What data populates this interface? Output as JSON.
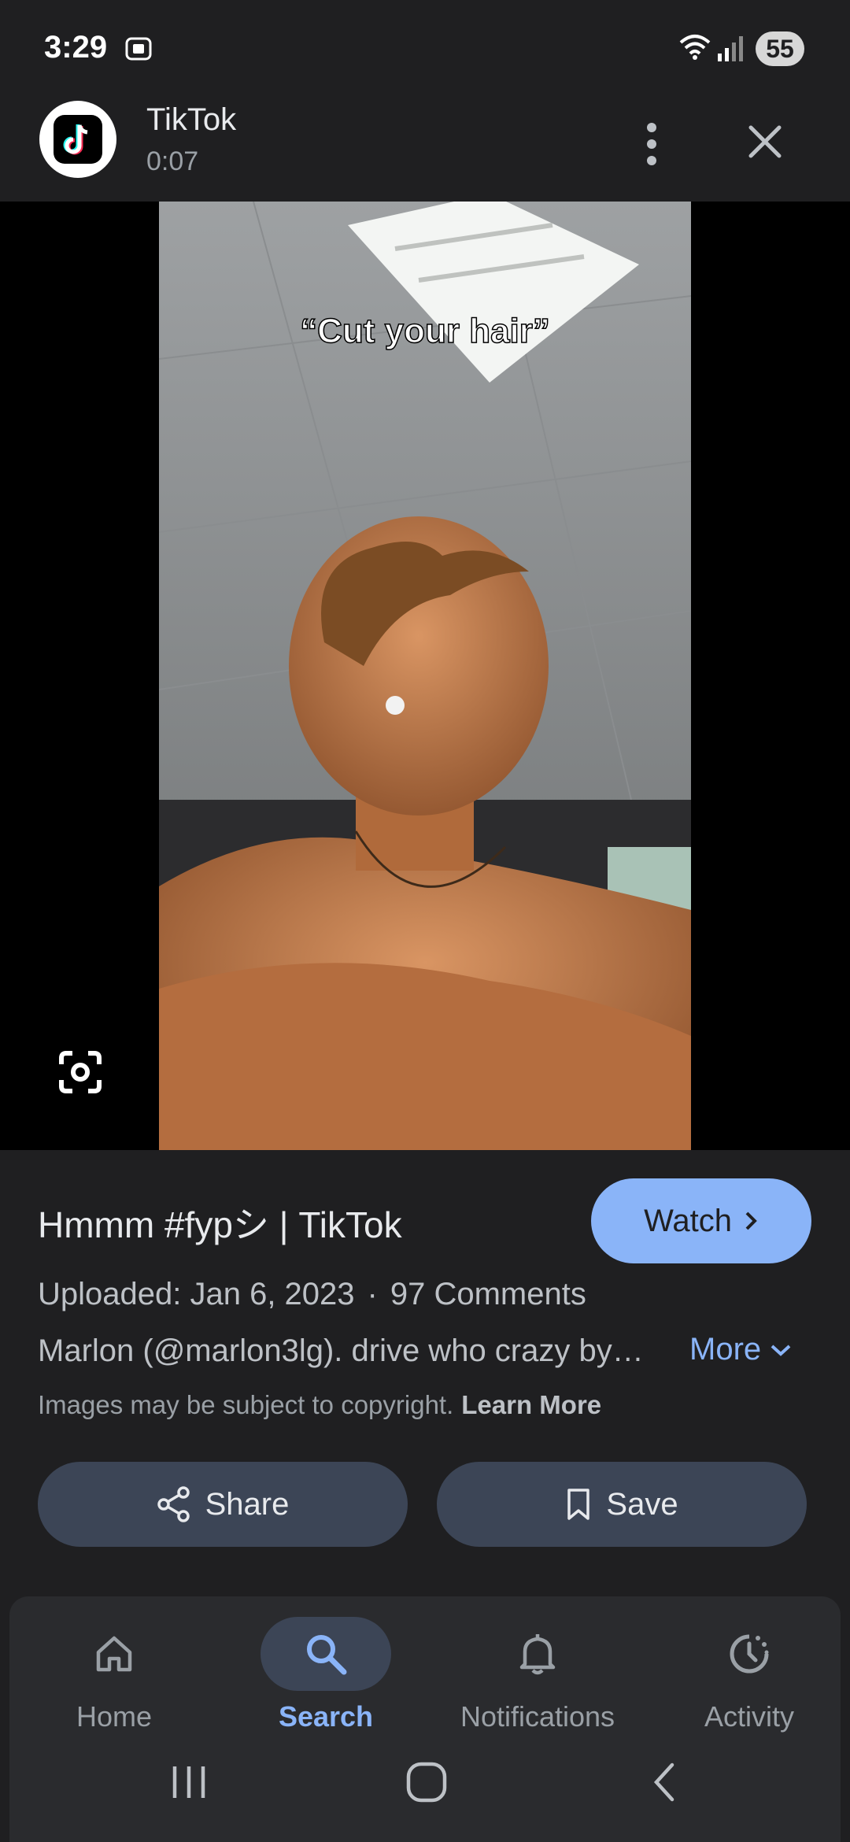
{
  "status_bar": {
    "time": "3:29",
    "battery": "55"
  },
  "header": {
    "app_name": "TikTok",
    "duration": "0:07"
  },
  "media": {
    "caption": "“Cut your hair”"
  },
  "info": {
    "title": "Hmmm #fypシ | TikTok",
    "watch_label": "Watch",
    "uploaded": "Uploaded: Jan 6, 2023",
    "separator": "·",
    "comments": "97 Comments",
    "description": "Marlon (@marlon3lg). drive who crazy by…",
    "more_label": "More",
    "copyright_text": "Images may be subject to copyright.",
    "learn_more": "Learn More"
  },
  "actions": {
    "share_label": "Share",
    "save_label": "Save"
  },
  "nav": {
    "items": [
      {
        "label": "Home",
        "icon": "home-icon"
      },
      {
        "label": "Search",
        "icon": "search-icon",
        "active": true
      },
      {
        "label": "Notifications",
        "icon": "bell-icon"
      },
      {
        "label": "Activity",
        "icon": "activity-icon"
      }
    ]
  },
  "colors": {
    "accent": "#8ab4f8",
    "background": "#1f1f21",
    "button": "#3c4556"
  }
}
